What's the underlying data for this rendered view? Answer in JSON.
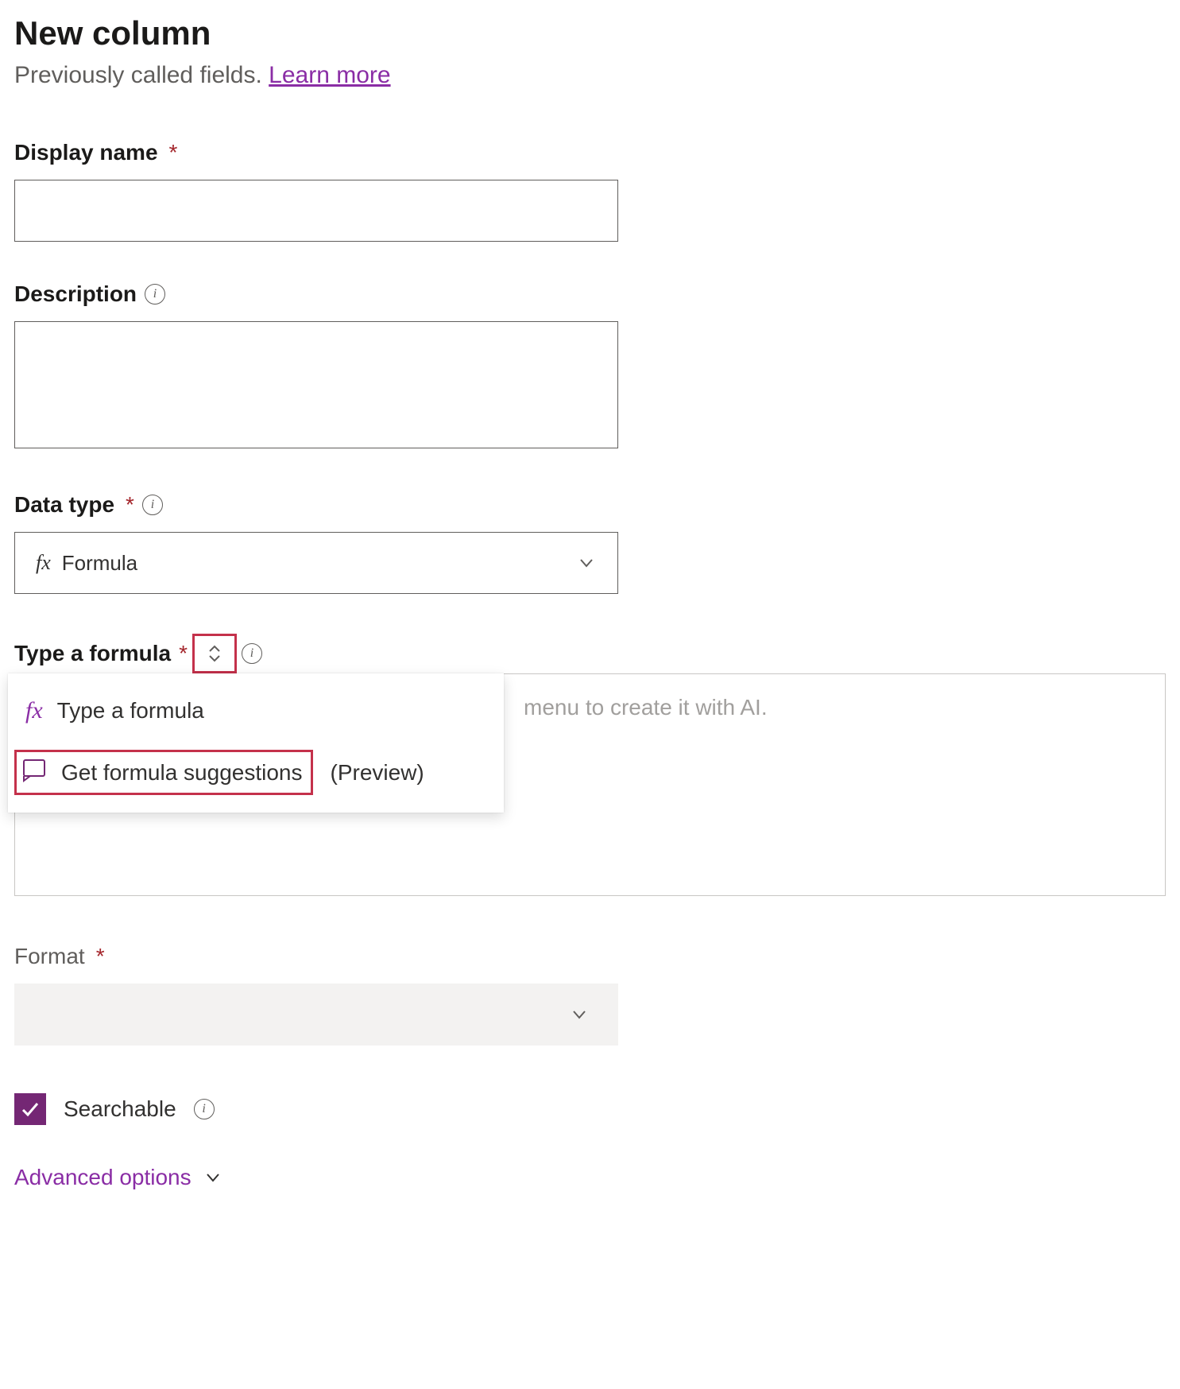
{
  "header": {
    "title": "New column",
    "subtitle_prefix": "Previously called fields. ",
    "learn_more": "Learn more"
  },
  "fields": {
    "display_name": {
      "label": "Display name",
      "value": ""
    },
    "description": {
      "label": "Description",
      "value": ""
    },
    "data_type": {
      "label": "Data type",
      "value": "Formula",
      "fx": "fx"
    },
    "formula": {
      "label": "Type a formula",
      "placeholder_suffix": "menu to create it with AI.",
      "dropdown": {
        "type_option": "Type a formula",
        "suggestions_option": "Get formula suggestions",
        "preview_tag": "(Preview)"
      }
    },
    "format": {
      "label": "Format"
    },
    "searchable": {
      "label": "Searchable",
      "checked": true
    }
  },
  "advanced_options": "Advanced options"
}
